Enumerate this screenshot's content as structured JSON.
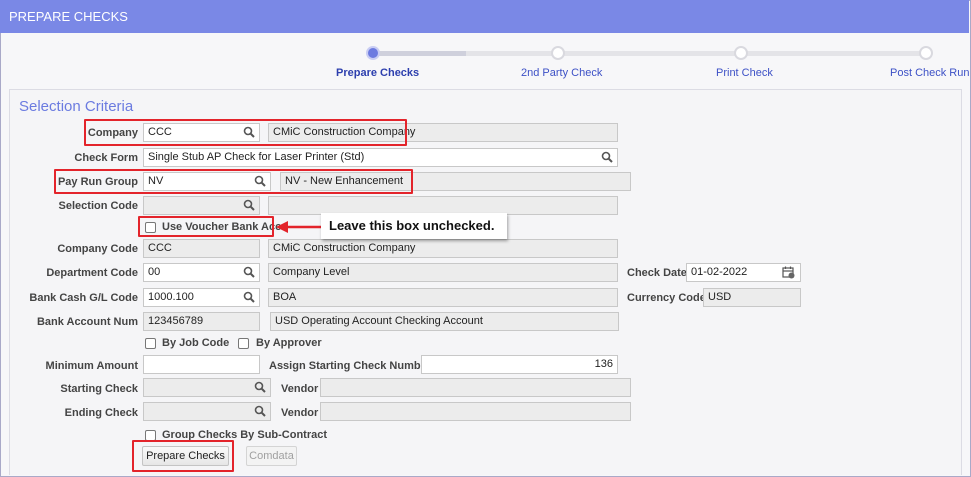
{
  "window": {
    "title": "PREPARE CHECKS"
  },
  "steps": [
    {
      "label": "Prepare Checks",
      "active": true
    },
    {
      "label": "2nd Party Check",
      "active": false
    },
    {
      "label": "Print Check",
      "active": false
    },
    {
      "label": "Post Check Run",
      "active": false
    }
  ],
  "section": {
    "title": "Selection Criteria"
  },
  "form": {
    "company": {
      "label": "Company",
      "code": "CCC",
      "name": "CMiC Construction Company"
    },
    "check_form": {
      "label": "Check Form",
      "value": "Single Stub AP Check for Laser Printer (Std)"
    },
    "pay_run_group": {
      "label": "Pay Run Group",
      "code": "NV",
      "name": "NV - New Enhancement"
    },
    "selection_code": {
      "label": "Selection Code",
      "code": "",
      "name": ""
    },
    "use_voucher_bank": {
      "label": "Use Voucher Bank Acc",
      "checked": false
    },
    "company_code": {
      "label": "Company Code",
      "code": "CCC",
      "name": "CMiC Construction Company"
    },
    "department_code": {
      "label": "Department Code",
      "code": "00",
      "name": "Company Level"
    },
    "check_date": {
      "label": "Check Date",
      "value": "01-02-2022"
    },
    "bank_cash_gl": {
      "label": "Bank Cash G/L Code",
      "code": "1000.100",
      "name": "BOA"
    },
    "currency_code": {
      "label": "Currency Code",
      "value": "USD"
    },
    "bank_account_num": {
      "label": "Bank Account Num",
      "code": "123456789",
      "name": "USD Operating Account Checking Account"
    },
    "by_job_code": {
      "label": "By Job Code",
      "checked": false
    },
    "by_approver": {
      "label": "By Approver",
      "checked": false
    },
    "minimum_amount": {
      "label": "Minimum Amount",
      "value": ""
    },
    "assign_starting": {
      "label": "Assign Starting Check Number",
      "value": "136"
    },
    "starting_check": {
      "label": "Starting Check",
      "value": "",
      "vendor_label": "Vendor",
      "vendor": ""
    },
    "ending_check": {
      "label": "Ending Check",
      "value": "",
      "vendor_label": "Vendor",
      "vendor": ""
    },
    "group_checks": {
      "label": "Group Checks By Sub-Contract",
      "checked": false
    }
  },
  "buttons": {
    "prepare_checks": "Prepare Checks",
    "comdata": "Comdata"
  },
  "annotation": {
    "callout": "Leave this box unchecked."
  },
  "colors": {
    "header": "#7a88e6",
    "accent": "#6c7ae0",
    "highlight": "#e3242b"
  },
  "icons": [
    "search-icon",
    "calendar-icon",
    "arrow-left-icon"
  ]
}
